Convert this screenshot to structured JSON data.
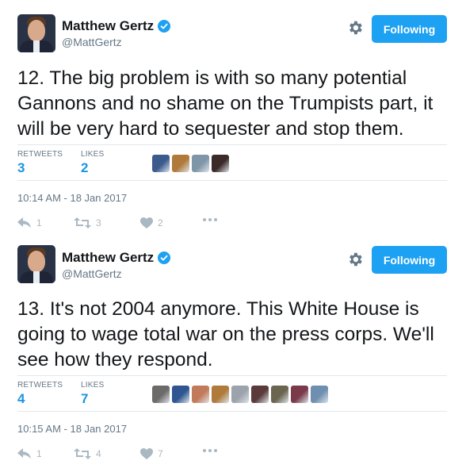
{
  "tweets": [
    {
      "author": {
        "name": "Matthew Gertz",
        "handle": "@MattGertz"
      },
      "follow_label": "Following",
      "text": "12. The big problem is with so many potential Gannons and no shame on the Trumpists part, it will be very hard to sequester and stop them.",
      "retweets_label": "RETWEETS",
      "retweets": "3",
      "likes_label": "LIKES",
      "likes": "2",
      "liker_colors": [
        "#3b5b8c",
        "#b07a3a",
        "#7f95a8",
        "#3a2a28"
      ],
      "timestamp": "10:14 AM - 18 Jan 2017",
      "actions": {
        "reply": "1",
        "retweet": "3",
        "like": "2"
      }
    },
    {
      "author": {
        "name": "Matthew Gertz",
        "handle": "@MattGertz"
      },
      "follow_label": "Following",
      "text": "13. It's not 2004 anymore. This White House is going to wage total war on the press corps. We'll see how they respond.",
      "retweets_label": "RETWEETS",
      "retweets": "4",
      "likes_label": "LIKES",
      "likes": "7",
      "liker_colors": [
        "#6d6a6a",
        "#2f5690",
        "#c27b5a",
        "#b07a3a",
        "#9ca3ad",
        "#5a3a3a",
        "#6b6550",
        "#7a3a4a",
        "#6f8fb0"
      ],
      "timestamp": "10:15 AM - 18 Jan 2017",
      "actions": {
        "reply": "1",
        "retweet": "4",
        "like": "7"
      }
    }
  ],
  "colors": {
    "accent": "#1da1f2",
    "stat_value": "#1b95e0",
    "muted": "#657786",
    "action_icon": "#aab8c2"
  }
}
